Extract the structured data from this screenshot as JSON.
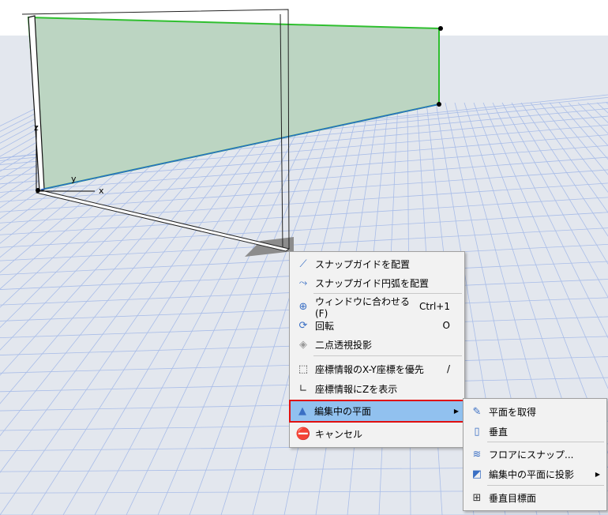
{
  "axes": {
    "x": "x",
    "y": "y",
    "z": "z"
  },
  "context_menu": {
    "items": [
      {
        "label": "スナップガイドを配置",
        "icon": "snap-guide-icon"
      },
      {
        "label": "スナップガイド円弧を配置",
        "icon": "snap-guide-arc-icon"
      },
      {
        "label": "ウィンドウに合わせる(F)",
        "shortcut": "Ctrl+1",
        "icon": "fit-window-icon"
      },
      {
        "label": "回転",
        "shortcut": "O",
        "icon": "rotate-icon"
      },
      {
        "label": "二点透視投影",
        "icon": "two-point-perspective-icon"
      },
      {
        "label": "座標情報のX-Y座標を優先",
        "shortcut": "/",
        "icon": "xy-priority-icon"
      },
      {
        "label": "座標情報にZを表示",
        "icon": "show-z-icon"
      },
      {
        "label": "編集中の平面",
        "icon": "editing-plane-icon"
      },
      {
        "label": "キャンセル",
        "icon": "cancel-icon"
      }
    ]
  },
  "submenu": {
    "items": [
      {
        "label": "平面を取得",
        "icon": "pick-plane-icon"
      },
      {
        "label": "垂直",
        "icon": "vertical-icon"
      },
      {
        "label": "フロアにスナップ...",
        "icon": "snap-floor-icon"
      },
      {
        "label": "編集中の平面に投影",
        "icon": "project-plane-icon"
      },
      {
        "label": "垂直目標面",
        "icon": "vertical-target-icon"
      }
    ]
  }
}
